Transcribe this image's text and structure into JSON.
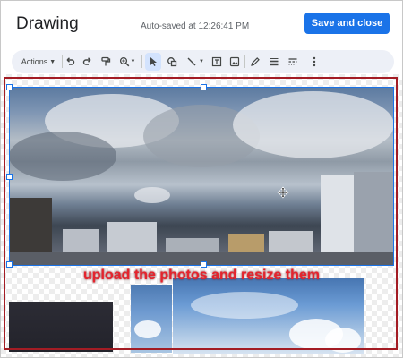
{
  "header": {
    "title": "Drawing",
    "autosave": "Auto-saved at 12:26:41 PM",
    "save_button": "Save and close"
  },
  "toolbar": {
    "actions_label": "Actions",
    "tools": [
      "undo-icon",
      "redo-icon",
      "paint-format-icon",
      "zoom-icon",
      "select-icon",
      "shape-icon",
      "line-icon",
      "textbox-icon",
      "image-icon",
      "pen-icon",
      "line-weight-icon",
      "line-dash-icon",
      "more-icon"
    ],
    "selected_tool": "select-icon"
  },
  "canvas": {
    "overlay_text": "upload the photos and resize them"
  },
  "colors": {
    "accent": "#1a73e8",
    "annotation_red": "#e6232d",
    "frame_red": "#a31c24"
  }
}
